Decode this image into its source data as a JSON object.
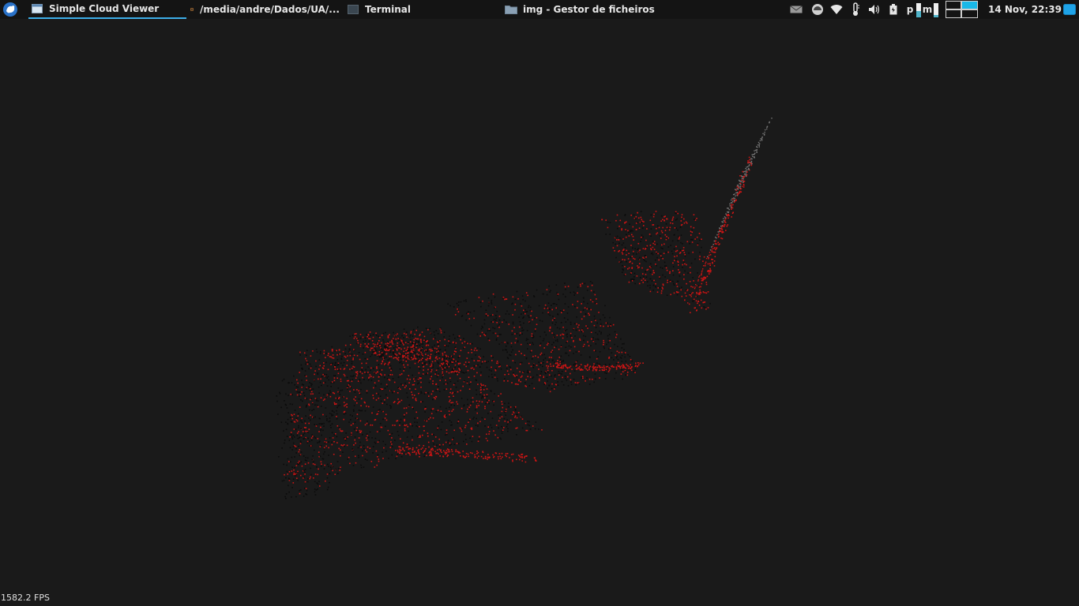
{
  "panel": {
    "tasks": [
      {
        "label": "Simple Cloud Viewer",
        "active": true
      },
      {
        "label": "/media/andre/Dados/UA/...",
        "active": false
      },
      {
        "label": "Terminal",
        "active": false
      },
      {
        "label": "img - Gestor de ficheiros",
        "active": false
      }
    ],
    "tray": {
      "keyboard_label": "p",
      "layout_label": "m"
    },
    "clock": "14 Nov, 22:39"
  },
  "viewer": {
    "fps_text": "1582.2 FPS",
    "background_color": "#1a1a1a",
    "point_color_primary": "#d01414",
    "point_color_secondary": "#0b0b0b",
    "point_color_tertiary": "#7a7a7a"
  }
}
